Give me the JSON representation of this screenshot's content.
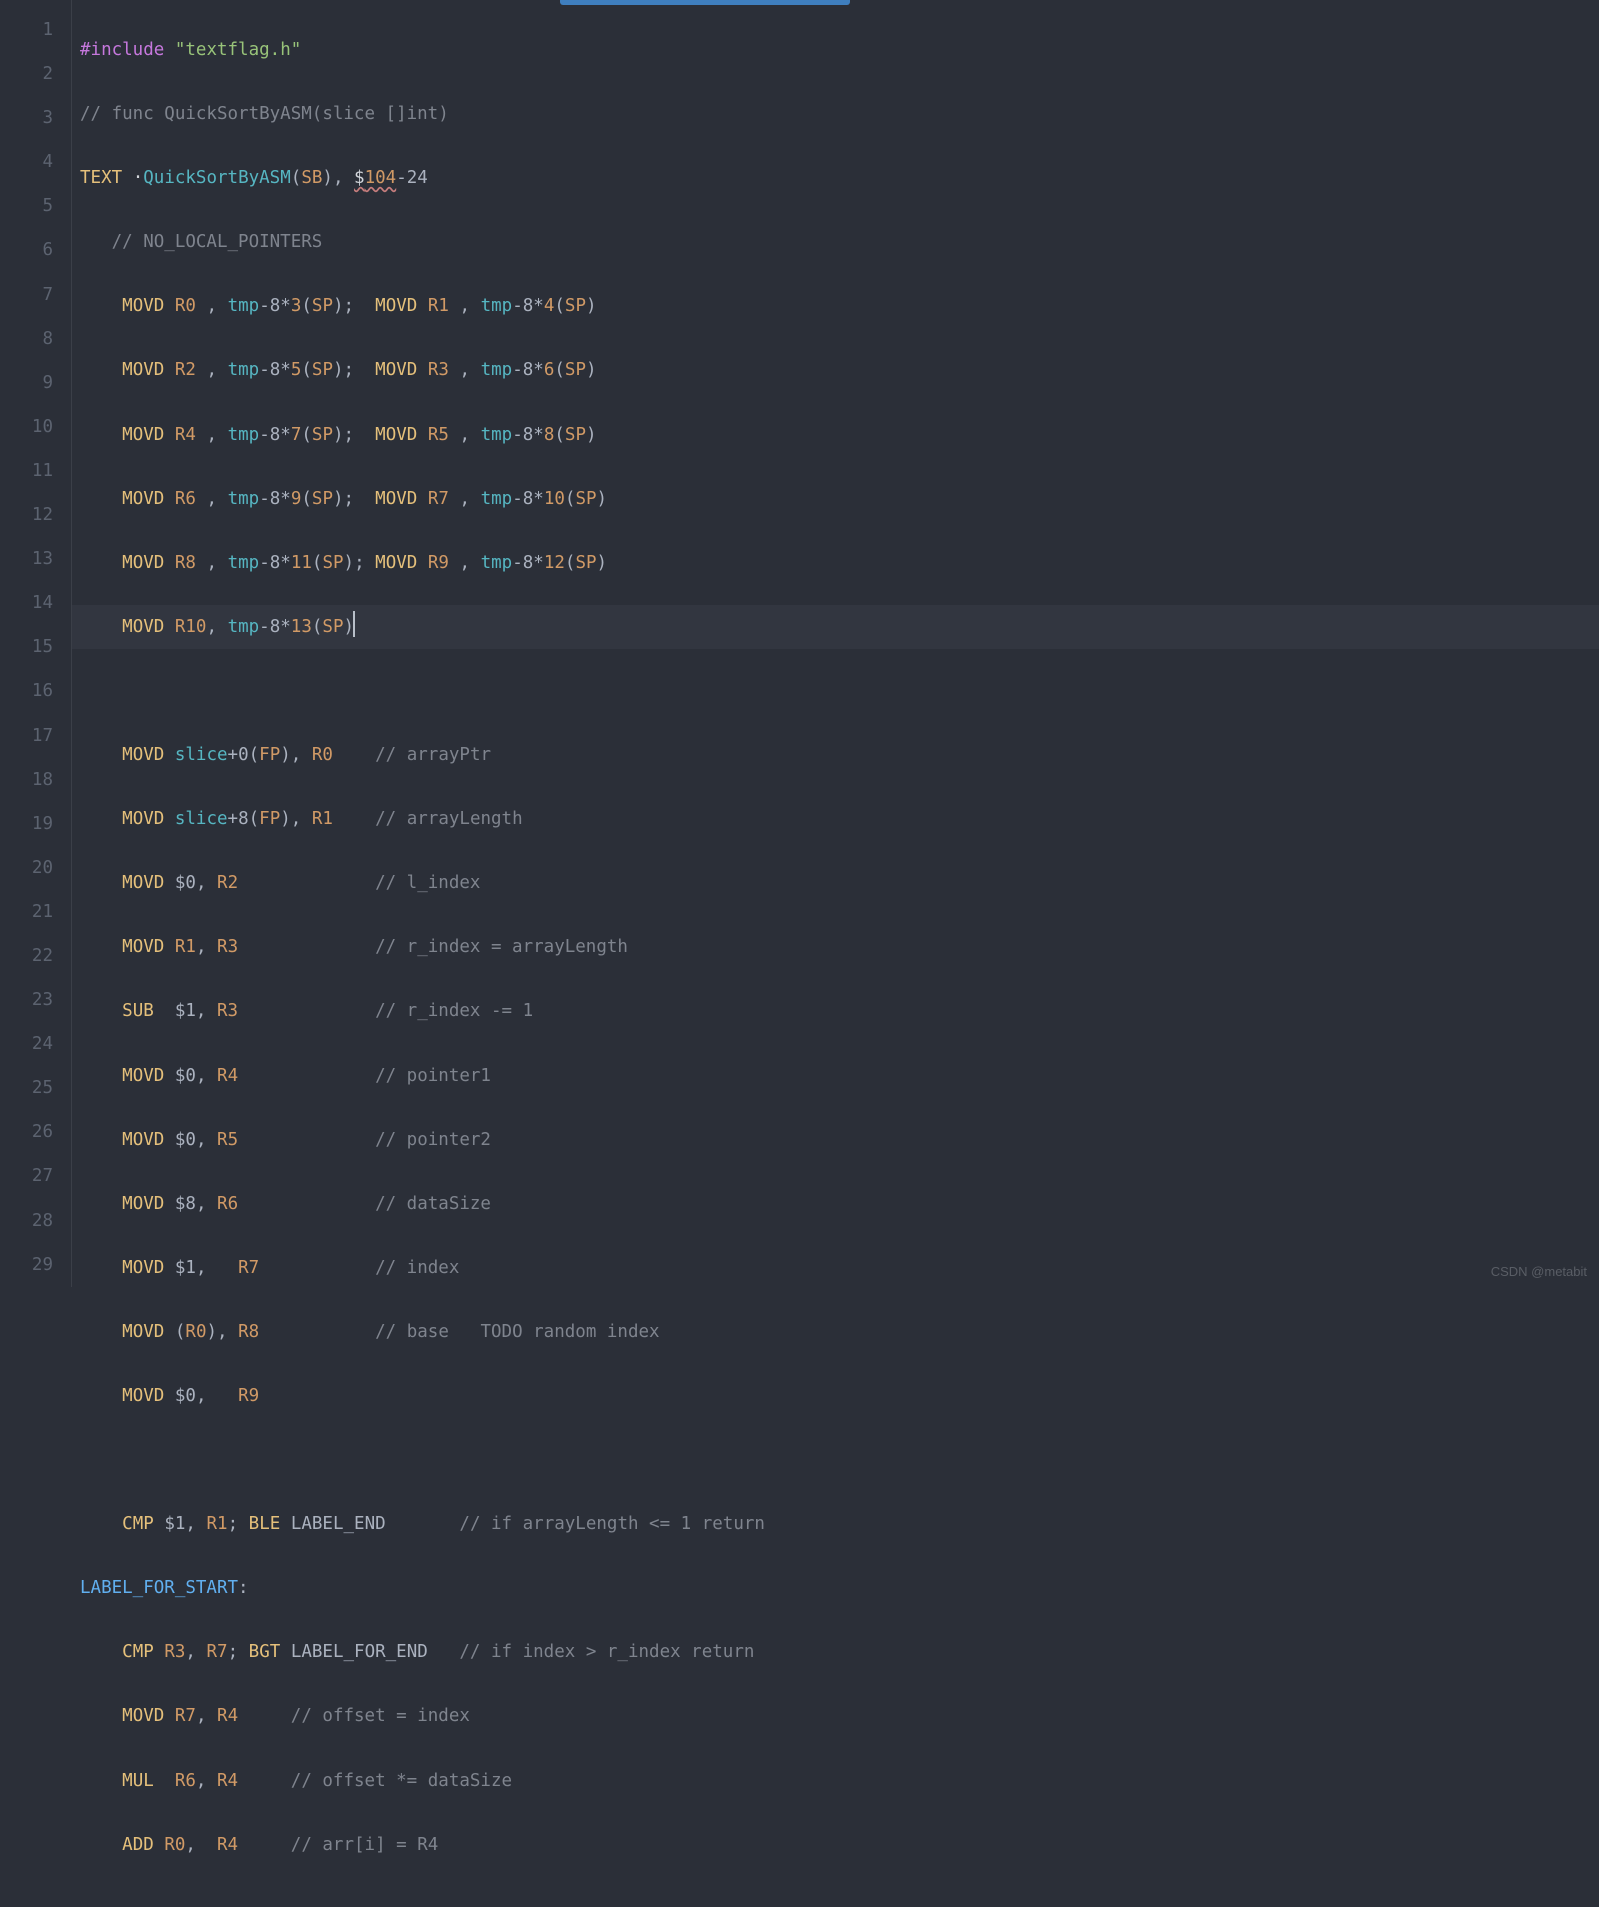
{
  "watermark": "CSDN @metabit",
  "gutter": [
    "1",
    "2",
    "3",
    "4",
    "5",
    "6",
    "7",
    "8",
    "9",
    "10",
    "11",
    "12",
    "13",
    "14",
    "15",
    "16",
    "17",
    "18",
    "19",
    "20",
    "21",
    "22",
    "23",
    "24",
    "25",
    "26",
    "27",
    "28",
    "29"
  ],
  "code": {
    "l1_include": "#include",
    "l1_str": "\"textflag.h\"",
    "l2_cmt": "// func QuickSortByASM(slice []int)",
    "l3_text": "TEXT",
    "l3_dot": "·",
    "l3_fn": "QuickSortByASM",
    "l3_sb": "SB",
    "l3_stack1": "$",
    "l3_stack2": "104",
    "l3_stack3": "-24",
    "l4_cmt": "// NO_LOCAL_POINTERS",
    "movd": "MOVD",
    "sub": "SUB",
    "cmp": "CMP",
    "ble": "BLE",
    "bgt": "BGT",
    "mul": "MUL",
    "add": "ADD",
    "tmp": "tmp",
    "slice": "slice",
    "SP": "SP",
    "FP": "FP",
    "R0": "R0",
    "R1": "R1",
    "R2": "R2",
    "R3": "R3",
    "R4": "R4",
    "R5": "R5",
    "R6": "R6",
    "R7": "R7",
    "R8": "R8",
    "R9": "R9",
    "R10": "R10",
    "n0": "0",
    "n1": "1",
    "n3": "3",
    "n4": "4",
    "n5": "5",
    "n6": "6",
    "n7": "7",
    "n8": "8",
    "n9": "9",
    "n10": "10",
    "n11": "11",
    "n12": "12",
    "n13": "13",
    "d0": "$0",
    "d1": "$1",
    "d8": "$8",
    "cmt_arrPtr": "// arrayPtr",
    "cmt_arrLen": "// arrayLength",
    "cmt_lidx": "// l_index",
    "cmt_ridx": "// r_index = arrayLength",
    "cmt_rdec": "// r_index -= 1",
    "cmt_p1": "// pointer1",
    "cmt_p2": "// pointer2",
    "cmt_ds": "// dataSize",
    "cmt_idx": "// index",
    "cmt_base": "// base   TODO random index",
    "cmt_ifL": "// if arrayLength <= 1 return",
    "cmt_ifI": "// if index > r_index return",
    "cmt_off": "// offset = index",
    "cmt_offm": "// offset *= dataSize",
    "cmt_arri": "// arr[i] = R4",
    "lbl_start": "LABEL_FOR_START",
    "lbl_end": "LABEL_END",
    "lbl_forend": "LABEL_FOR_END",
    "minus8": "-8",
    "star": "*",
    "plus": "+",
    "plus0": "+0",
    "plus8": "+8",
    "lp": "(",
    "rp": ")",
    "sc": ";",
    "cm": ",",
    "col": ":"
  }
}
